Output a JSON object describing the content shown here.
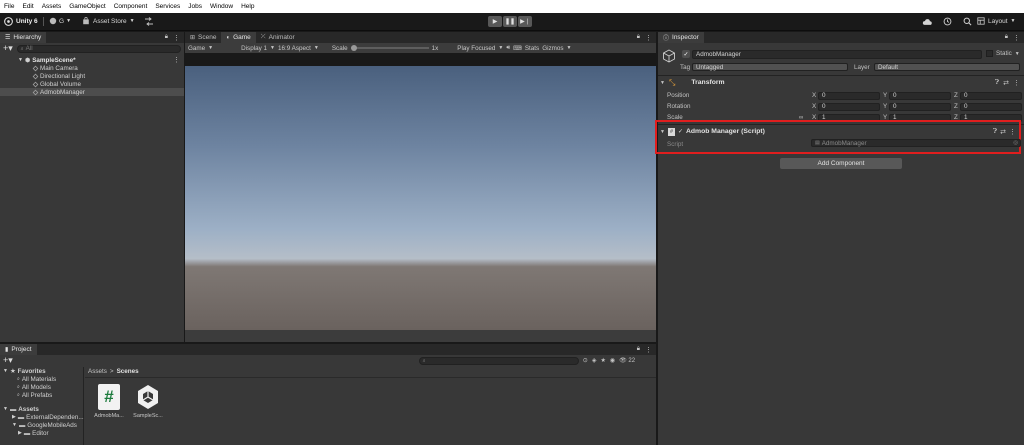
{
  "menu": [
    "File",
    "Edit",
    "Assets",
    "GameObject",
    "Component",
    "Services",
    "Jobs",
    "Window",
    "Help"
  ],
  "toolbar": {
    "version": "Unity 6",
    "account": "G",
    "asset_store": "Asset Store",
    "layout": "Layout"
  },
  "hierarchy": {
    "tab": "Hierarchy",
    "search_placeholder": "All",
    "scene": "SampleScene*",
    "items": [
      "Main Camera",
      "Directional Light",
      "Global Volume",
      "AdmobManager"
    ]
  },
  "center_tabs": [
    "Scene",
    "Game",
    "Animator"
  ],
  "game_bar": {
    "mode": "Game",
    "display": "Display 1",
    "aspect": "16:9 Aspect",
    "scale_label": "Scale",
    "scale_value": "1x",
    "play_focused": "Play Focused",
    "stats": "Stats",
    "gizmos": "Gizmos"
  },
  "inspector": {
    "tab": "Inspector",
    "object_name": "AdmobManager",
    "static": "Static",
    "tag_label": "Tag",
    "tag_value": "Untagged",
    "layer_label": "Layer",
    "layer_value": "Default",
    "transform": {
      "title": "Transform",
      "rows": [
        {
          "label": "Position",
          "x": "0",
          "y": "0",
          "z": "0"
        },
        {
          "label": "Rotation",
          "x": "0",
          "y": "0",
          "z": "0"
        },
        {
          "label": "Scale",
          "x": "1",
          "y": "1",
          "z": "1"
        }
      ],
      "axis_x": "X",
      "axis_y": "Y",
      "axis_z": "Z"
    },
    "script_component": {
      "title": "Admob Manager (Script)",
      "script_label": "Script",
      "script_value": "AdmobManager",
      "highlight_color": "#e01e1e"
    },
    "add_component": "Add Component"
  },
  "project": {
    "tab": "Project",
    "count": "22",
    "favorites_label": "Favorites",
    "favorites": [
      "All Materials",
      "All Models",
      "All Prefabs"
    ],
    "assets_label": "Assets",
    "asset_tree": [
      "ExternalDependen...",
      "GoogleMobileAds",
      "Editor"
    ],
    "breadcrumb_root": "Assets",
    "breadcrumb_sep": ">",
    "breadcrumb_current": "Scenes",
    "files": [
      {
        "name": "AdmobMa...",
        "icon": "csharp-script-icon"
      },
      {
        "name": "SampleSc...",
        "icon": "unity-scene-icon"
      }
    ]
  }
}
